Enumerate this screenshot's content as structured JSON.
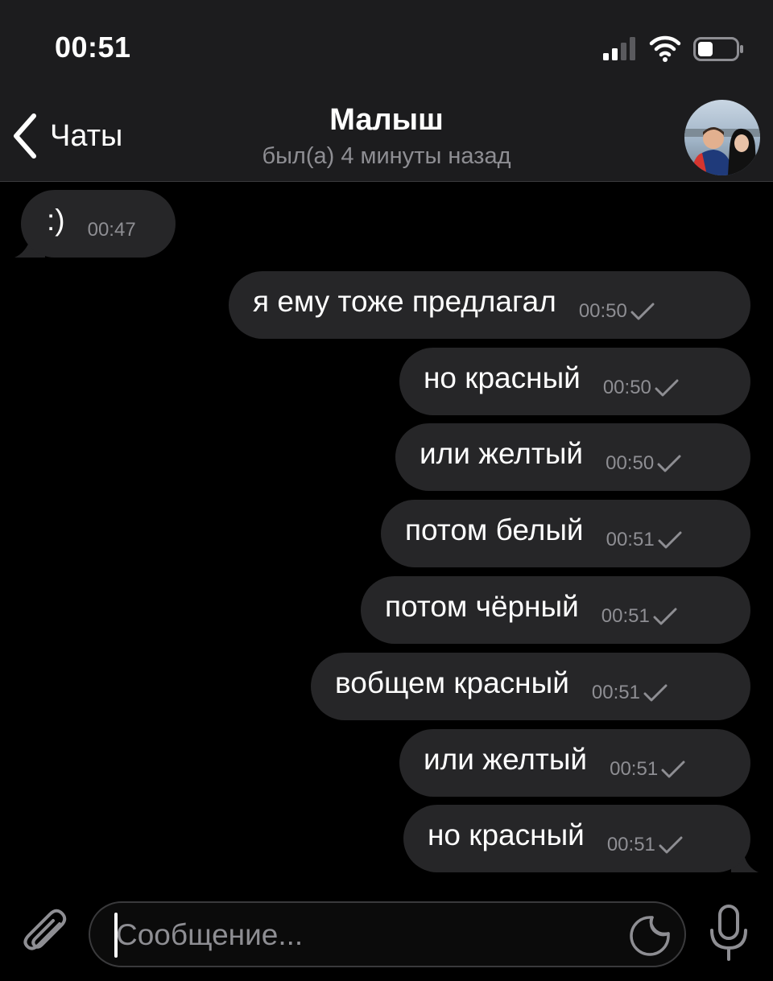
{
  "status_bar": {
    "time": "00:51",
    "icons": [
      "cellular-signal-icon",
      "wifi-icon",
      "battery-icon"
    ]
  },
  "header": {
    "back_label": "Чаты",
    "title": "Малыш",
    "subtitle": "был(а) 4 минуты назад",
    "back_icon": "chevron-left-icon",
    "avatar": "contact-avatar"
  },
  "messages": [
    {
      "direction": "incoming",
      "text": ":)",
      "time": "00:47"
    },
    {
      "direction": "outgoing",
      "text": "я ему тоже предлагал",
      "time": "00:50",
      "status": "sent-check-icon"
    },
    {
      "direction": "outgoing",
      "text": "но красный",
      "time": "00:50",
      "status": "sent-check-icon"
    },
    {
      "direction": "outgoing",
      "text": "или желтый",
      "time": "00:50",
      "status": "sent-check-icon"
    },
    {
      "direction": "outgoing",
      "text": "потом белый",
      "time": "00:51",
      "status": "sent-check-icon"
    },
    {
      "direction": "outgoing",
      "text": "потом чёрный",
      "time": "00:51",
      "status": "sent-check-icon"
    },
    {
      "direction": "outgoing",
      "text": "вобщем красный",
      "time": "00:51",
      "status": "sent-check-icon"
    },
    {
      "direction": "outgoing",
      "text": "или желтый",
      "time": "00:51",
      "status": "sent-check-icon"
    },
    {
      "direction": "outgoing",
      "text": "но красный",
      "time": "00:51",
      "status": "sent-check-icon"
    }
  ],
  "composer": {
    "placeholder": "Сообщение...",
    "value": "",
    "attach_icon": "paperclip-icon",
    "sticker_icon": "sticker-icon",
    "mic_icon": "microphone-icon"
  },
  "colors": {
    "background": "#000000",
    "header_background": "#1c1c1e",
    "bubble": "#262628",
    "secondary_text": "#8e8e93"
  }
}
